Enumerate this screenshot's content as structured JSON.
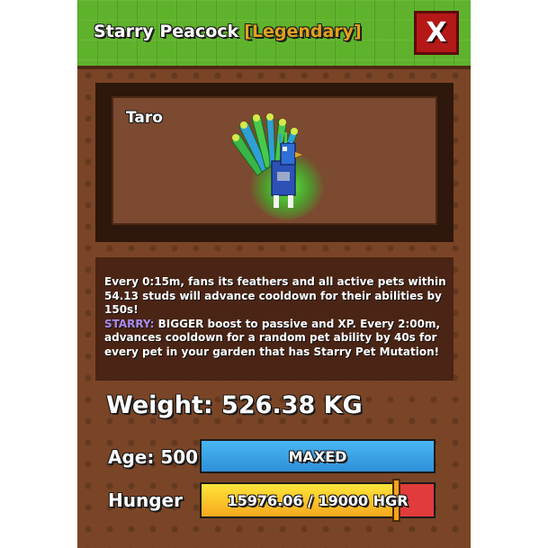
{
  "header": {
    "pet_type": "Starry Peacock",
    "rarity": "[Legendary]",
    "close_label": "X",
    "colors": {
      "header_bg": "#5fb32c",
      "rarity": "#e0a21f",
      "close_bg": "#b41817"
    }
  },
  "preview": {
    "pet_name": "Taro",
    "pet_icon": "peacock-pet-icon"
  },
  "description": {
    "line1": "Every 0:15m, fans its feathers and all active pets within",
    "line2": "54.13 studs will advance cooldown for their abilities by",
    "line3": "150s!",
    "starry_tag": "STARRY:",
    "line4_rest": " BIGGER boost to passive and XP. Every 2:00m,",
    "line5": "advances cooldown for a random pet ability by 40s for",
    "line6": "every pet in your garden that has Starry Pet Mutation!"
  },
  "stats": {
    "weight_text": "Weight: 526.38 KG",
    "age_label": "Age: 500",
    "age_bar_text": "MAXED",
    "age_progress": 1.0,
    "hunger_label": "Hunger",
    "hunger_text": "15976.06 / 19000 HGR",
    "hunger_current": 15976.06,
    "hunger_max": 19000,
    "colors": {
      "age_bar": "#3aa2e6",
      "hunger_fill": "#fcd232",
      "hunger_empty": "#e23b3b"
    }
  }
}
